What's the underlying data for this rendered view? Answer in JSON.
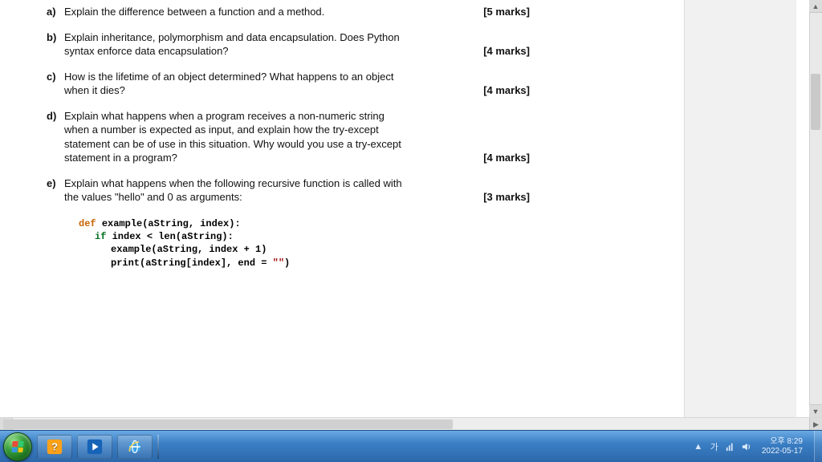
{
  "document": {
    "questions": [
      {
        "letter": "a)",
        "body_lines": [
          "Explain the difference between a function and a method."
        ],
        "marks": "[5 marks]",
        "marks_on_first_line": true
      },
      {
        "letter": "b)",
        "body_lines": [
          "Explain inheritance, polymorphism and data encapsulation. Does Python",
          "syntax enforce data encapsulation?"
        ],
        "marks": "[4 marks]",
        "marks_on_first_line": false
      },
      {
        "letter": "c)",
        "body_lines": [
          "How is the lifetime of an object determined? What happens to an object",
          "when it dies?"
        ],
        "marks": "[4 marks]",
        "marks_on_first_line": false
      },
      {
        "letter": "d)",
        "body_lines": [
          "Explain what happens when a program receives a non-numeric string",
          "when a number is expected as input, and explain how the try-except",
          "statement can be of use in this situation. Why would you use a try-except",
          "statement in a program?"
        ],
        "marks": "[4 marks]",
        "marks_on_first_line": false
      },
      {
        "letter": "e)",
        "body_lines": [
          "Explain what happens when the following recursive function is called with",
          "the values \"hello\" and 0 as arguments:"
        ],
        "marks": "[3 marks]",
        "marks_on_first_line": false
      }
    ],
    "code": {
      "l1_def": "def ",
      "l1_name": "example(aString, index):",
      "l2_if": "if ",
      "l2_cond": "index < len(aString):",
      "l3": "example(aString, index + 1)",
      "l4a": "print(aString[index], end = ",
      "l4b": "\"\"",
      "l4c": ")"
    }
  },
  "taskbar": {
    "clock_time": "오후 8:29",
    "clock_date": "2022-05-17"
  }
}
